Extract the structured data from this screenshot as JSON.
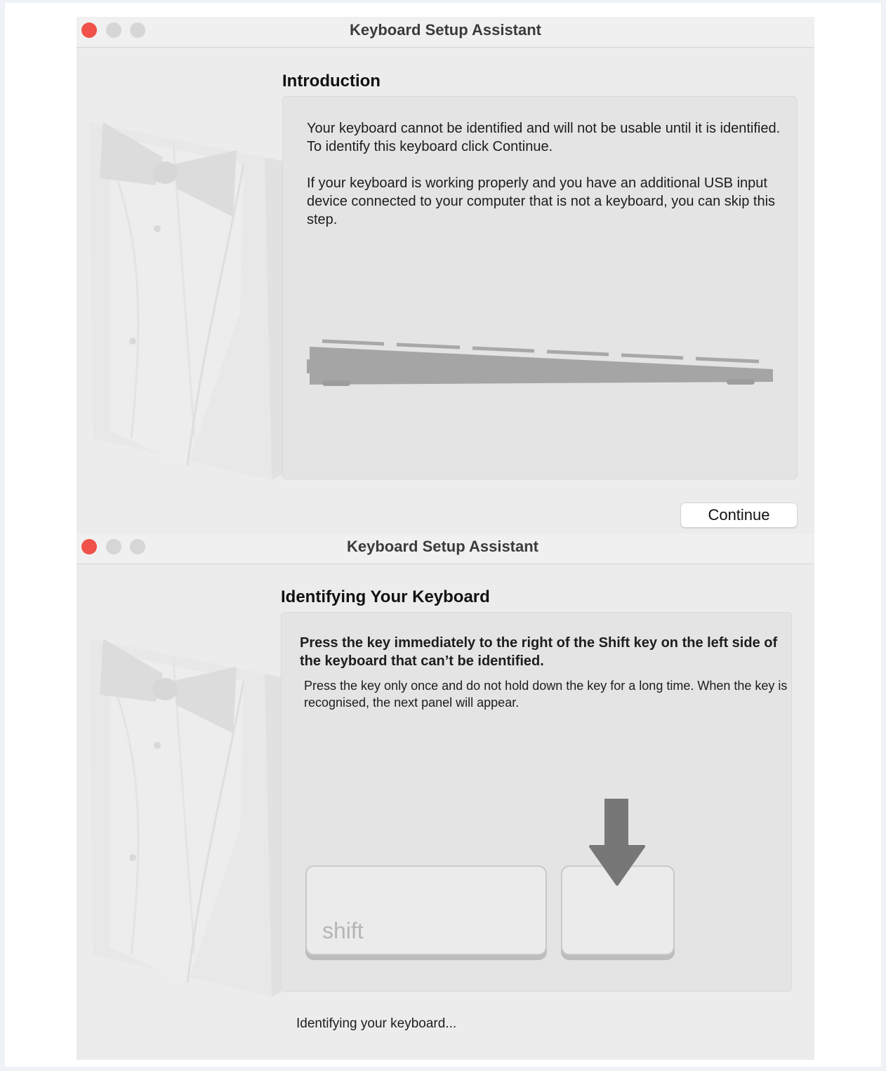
{
  "intro_window": {
    "title": "Keyboard Setup Assistant",
    "section_title": "Introduction",
    "paragraph1": "Your keyboard cannot be identified and will not be usable until it is identified. To identify this keyboard click Continue.",
    "paragraph2": "If your keyboard is working properly and you have an additional USB input device connected to your computer that is not a keyboard, you can skip this step.",
    "continue_label": "Continue"
  },
  "identify_window": {
    "title": "Keyboard Setup Assistant",
    "section_title": "Identifying Your Keyboard",
    "instruction_bold": "Press the key immediately to the right of the Shift key on the left side of the keyboard that can’t be identified.",
    "instruction_detail": "Press the key only once and do not hold down the key for a long time. When the key is recognised, the next panel will appear.",
    "shift_key_label": "shift",
    "status": "Identifying your keyboard..."
  },
  "colors": {
    "close_button": "#f0514a",
    "inactive_button": "#d6d6d6",
    "window_bg": "#ececec",
    "panel_bg": "#e4e4e4"
  },
  "icons": [
    "tuxedo-icon",
    "keyboard-icon",
    "down-arrow-icon"
  ]
}
